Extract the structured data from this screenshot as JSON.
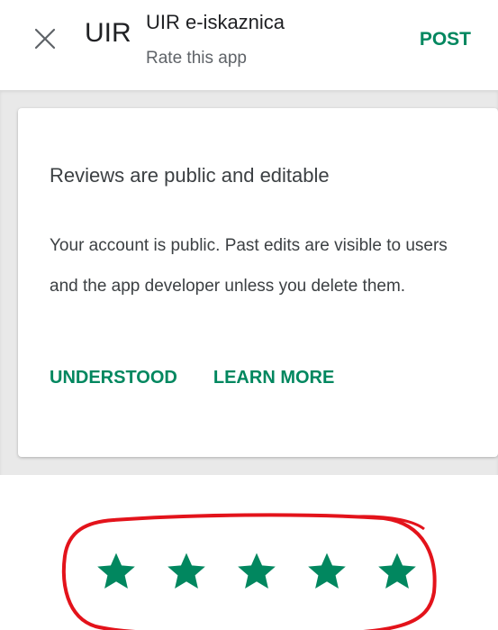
{
  "header": {
    "close_icon": "close-icon",
    "app_short_name": "UIR",
    "app_title": "UIR e-iskaznica",
    "subtitle": "Rate this app",
    "post_label": "POST"
  },
  "dialog": {
    "heading": "Reviews are public and editable",
    "body": "Your account is public. Past edits are visible to users and the app developer unless you delete them.",
    "understood_label": "UNDERSTOOD",
    "learn_more_label": "LEARN MORE"
  },
  "rating": {
    "star_icon": "star-icon",
    "max_stars": 5,
    "selected_stars": 5
  },
  "colors": {
    "accent": "#01875f",
    "annotation_ring": "#e3131b",
    "text_primary": "#202124",
    "text_secondary": "#5f6368",
    "band_background": "#e9e9e9"
  }
}
